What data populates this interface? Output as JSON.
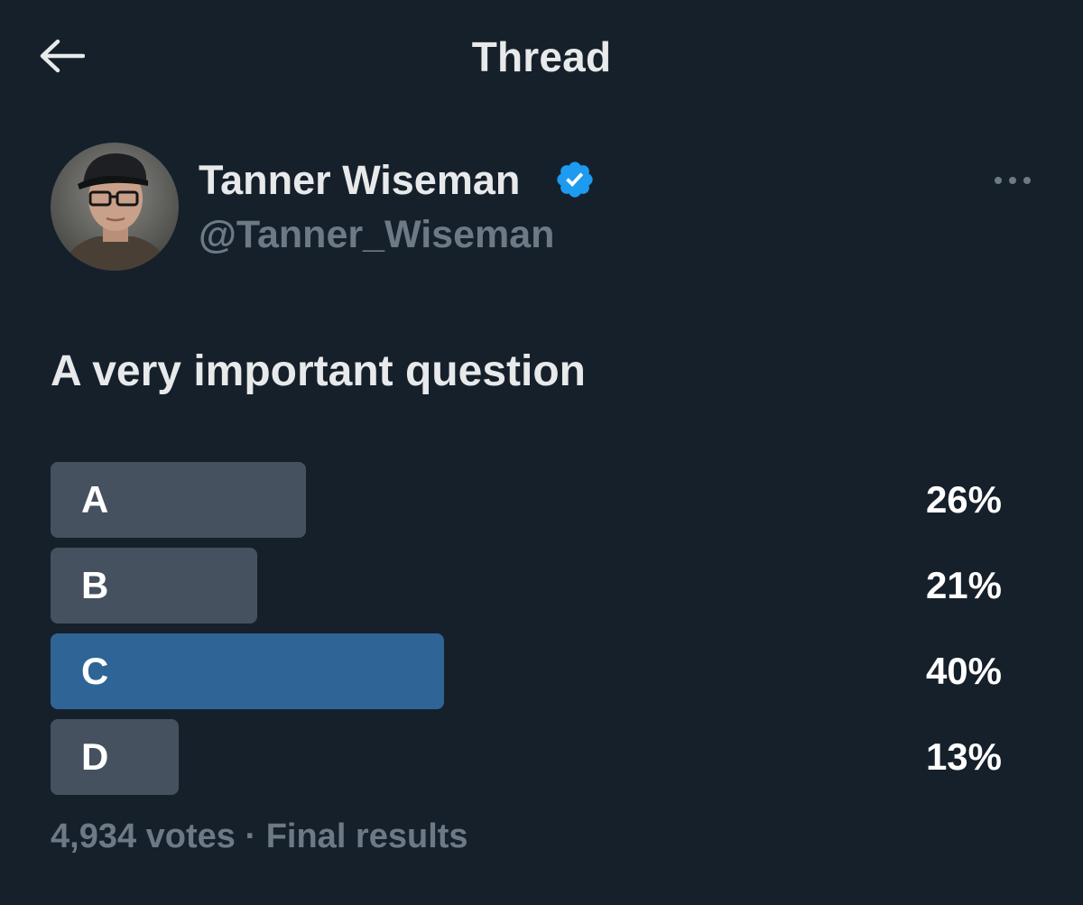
{
  "header": {
    "title": "Thread",
    "back_icon": "arrow-left-icon"
  },
  "author": {
    "display_name": "Tanner Wiseman",
    "handle": "@Tanner_Wiseman",
    "verified": true,
    "verified_icon": "verified-badge-icon",
    "more_icon": "more-horizontal-icon"
  },
  "tweet": {
    "text": "A very important question"
  },
  "poll": {
    "options": [
      {
        "label": "A",
        "percent_text": "26%",
        "percent": 26,
        "winner": false
      },
      {
        "label": "B",
        "percent_text": "21%",
        "percent": 21,
        "winner": false
      },
      {
        "label": "C",
        "percent_text": "40%",
        "percent": 40,
        "winner": true
      },
      {
        "label": "D",
        "percent_text": "13%",
        "percent": 13,
        "winner": false
      }
    ],
    "votes": "4,934 votes",
    "separator": "·",
    "status": "Final results"
  },
  "colors": {
    "background": "#16202b",
    "bar": "#45515e",
    "bar_winner": "#2f6496",
    "verified": "#1d9bf0",
    "muted_text": "#6d7a86"
  }
}
